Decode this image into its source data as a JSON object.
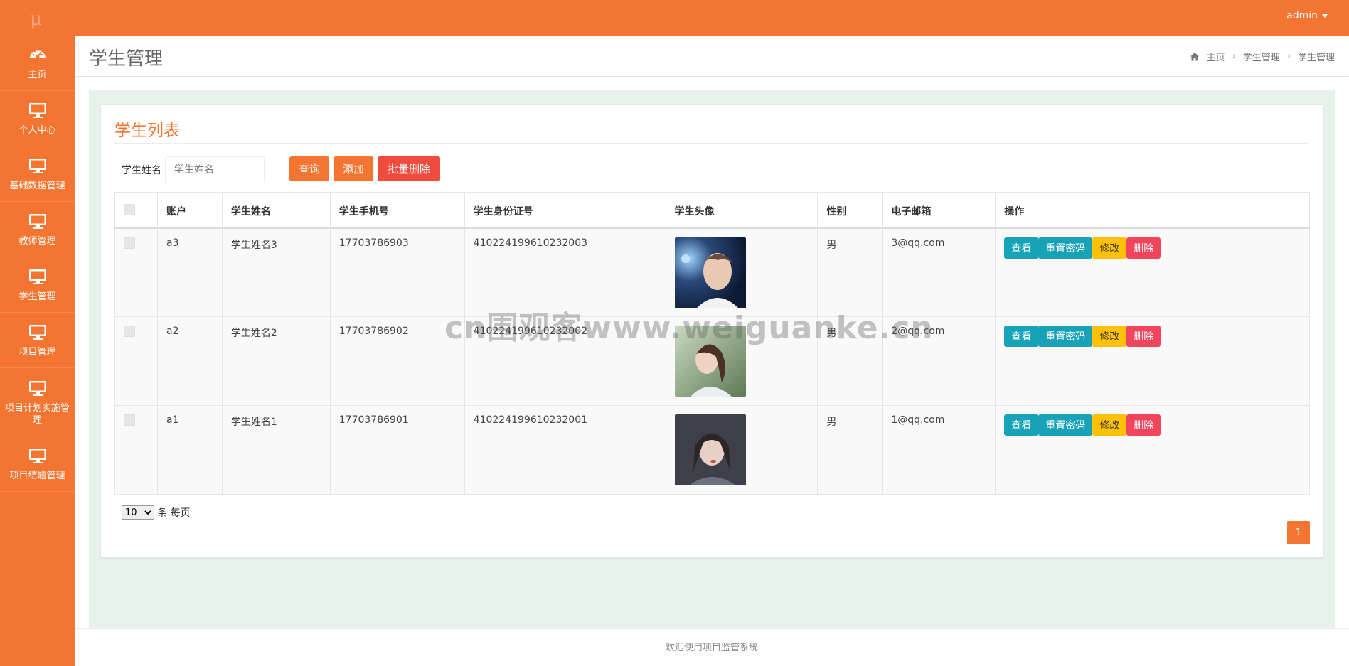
{
  "brand": {
    "logo": "μ"
  },
  "user": {
    "name": "admin"
  },
  "sidebar": {
    "items": [
      {
        "label": "主页",
        "icon": "dashboard-icon"
      },
      {
        "label": "个人中心",
        "icon": "monitor-icon"
      },
      {
        "label": "基础数据管理",
        "icon": "monitor-icon"
      },
      {
        "label": "教师管理",
        "icon": "monitor-icon"
      },
      {
        "label": "学生管理",
        "icon": "monitor-icon"
      },
      {
        "label": "项目管理",
        "icon": "monitor-icon"
      },
      {
        "label": "项目计划实施管理",
        "icon": "monitor-icon"
      },
      {
        "label": "项目结题管理",
        "icon": "monitor-icon"
      }
    ]
  },
  "header": {
    "title": "学生管理",
    "breadcrumb": [
      "主页",
      "学生管理",
      "学生管理"
    ]
  },
  "card": {
    "title": "学生列表"
  },
  "filter": {
    "label": "学生姓名",
    "placeholder": "学生姓名",
    "query": "查询",
    "add": "添加",
    "batch_delete": "批量删除"
  },
  "table": {
    "columns": [
      "账户",
      "学生姓名",
      "学生手机号",
      "学生身份证号",
      "学生头像",
      "性别",
      "电子邮箱",
      "操作"
    ],
    "rows": [
      {
        "account": "a3",
        "name": "学生姓名3",
        "phone": "17703786903",
        "id_number": "410224199610232003",
        "gender": "男",
        "email": "3@qq.com"
      },
      {
        "account": "a2",
        "name": "学生姓名2",
        "phone": "17703786902",
        "id_number": "410224199610232002",
        "gender": "男",
        "email": "2@qq.com"
      },
      {
        "account": "a1",
        "name": "学生姓名1",
        "phone": "17703786901",
        "id_number": "410224199610232001",
        "gender": "男",
        "email": "1@qq.com"
      }
    ],
    "actions": {
      "view": "查看",
      "reset": "重置密码",
      "edit": "修改",
      "delete": "删除"
    }
  },
  "pager": {
    "page_size": "10",
    "page_size_suffix": "条 每页",
    "current_page": "1"
  },
  "footer": {
    "text": "欢迎使用项目监管系统"
  },
  "watermark": "cn围观客www.weiguanke.cn",
  "colors": {
    "primary": "#f47532",
    "info": "#17a2b8",
    "warning": "#ffc107",
    "danger": "#f0455d"
  }
}
